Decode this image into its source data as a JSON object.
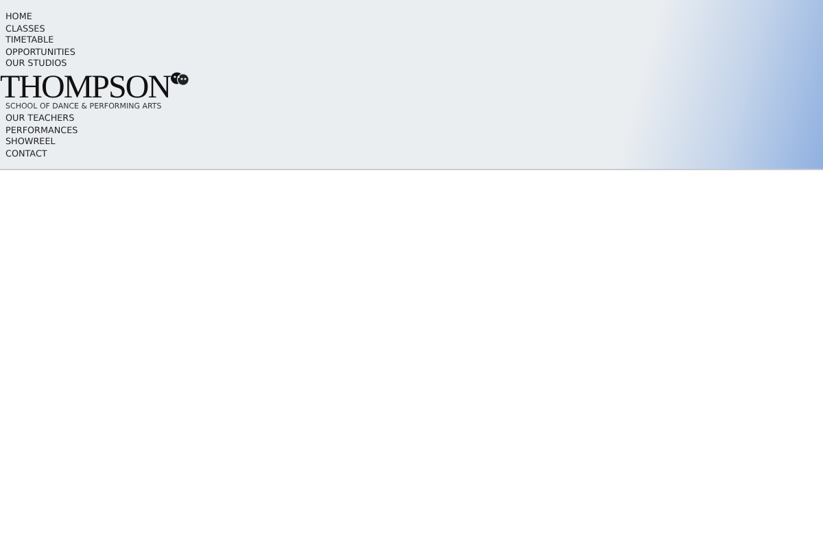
{
  "nav_top": [
    {
      "label": "HOME"
    },
    {
      "label": "CLASSES"
    },
    {
      "label": "TIMETABLE"
    },
    {
      "label": "OPPORTUNITIES"
    },
    {
      "label": "OUR STUDIOS"
    }
  ],
  "logo": {
    "name": "THOMPSON",
    "tagline": "SCHOOL OF DANCE & PERFORMING ARTS"
  },
  "nav_bottom": [
    {
      "label": "OUR TEACHERS"
    },
    {
      "label": "PERFORMANCES"
    },
    {
      "label": "SHOWREEL"
    },
    {
      "label": "CONTACT"
    }
  ]
}
